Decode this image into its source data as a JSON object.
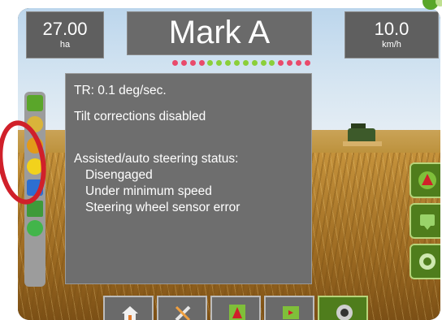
{
  "header": {
    "left": {
      "value": "27.00",
      "unit": "ha"
    },
    "title": "Mark A",
    "right": {
      "value": "10.0",
      "unit": "km/h"
    }
  },
  "info_panel": {
    "lines": [
      "TR: 0.1 deg/sec.",
      "Tilt corrections disabled",
      "Assisted/auto steering status:",
      "Disengaged",
      "Under minimum speed",
      "Steering wheel sensor error"
    ]
  },
  "colors": {
    "accent_green": "#4f7d1c",
    "highlight_ring": "#d0202a",
    "panel_gray": "#6e6e6e"
  },
  "status_dots": [
    "#e94a6b",
    "#e94a6b",
    "#e94a6b",
    "#e94a6b",
    "#8bcf3a",
    "#8bcf3a",
    "#8bcf3a",
    "#8bcf3a",
    "#8bcf3a",
    "#8bcf3a",
    "#8bcf3a",
    "#8bcf3a",
    "#e94a6b",
    "#e94a6b",
    "#e94a6b",
    "#e94a6b"
  ],
  "icons": {
    "left_strip": [
      "boom-width-icon",
      "section-icon",
      "auto-steer-icon",
      "tilt-module-icon",
      "steering-sensor-icon",
      "guidance-icon",
      "product-icon"
    ],
    "right": [
      "guidance-arrow-icon",
      "map-view-icon",
      "camera-icon"
    ],
    "bottom": [
      "home-icon",
      "tools-icon",
      "vehicle-view-icon",
      "field-view-icon",
      "camera-view-icon"
    ]
  }
}
